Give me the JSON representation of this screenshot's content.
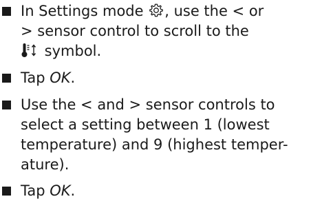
{
  "steps": [
    {
      "line1_a": "In Settings mode ",
      "gear_icon": "gear-icon",
      "line1_b": ", use the < or",
      "line2": "> sensor control to scroll to the",
      "temp_icon": "thermometer-updown-icon",
      "line3_b": " symbol."
    },
    {
      "prefix": "Tap ",
      "action": "OK",
      "suffix": "."
    },
    {
      "line1": "Use the < and > sensor controls to",
      "line2": "select a setting between 1 (lowest",
      "line3": "temperature) and 9 (highest temper-",
      "line4": "ature)."
    },
    {
      "prefix": "Tap ",
      "action": "OK",
      "suffix": "."
    }
  ]
}
